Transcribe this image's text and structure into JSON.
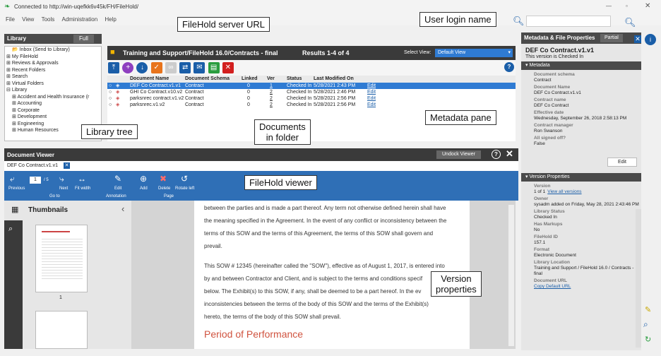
{
  "window": {
    "connected": "Connected to http://win-uqefkk6v45k/FH/FileHold/"
  },
  "menu": [
    "File",
    "View",
    "Tools",
    "Administration",
    "Help"
  ],
  "library": {
    "title": "Library",
    "full_button": "Full",
    "tree": [
      "Inbox (Send to Library)",
      "My FileHold",
      "Reviews & Approvals",
      "Recent Folders",
      "Search",
      "Virtual Folders",
      "Library",
      "Accident and Health Insurance (r",
      "Accounting",
      "Corporate",
      "Development",
      "Engineering",
      "Human Resources"
    ]
  },
  "folder": {
    "path": "Training and Support/FileHold 16.0/Contracts - final",
    "results": "Results 1-4 of 4",
    "select_view_label": "Select View:",
    "select_view_value": "Default View"
  },
  "grid": {
    "headers": [
      "Document Name",
      "Document Schema",
      "Linked",
      "Ver",
      "Status",
      "Last Modified On"
    ],
    "rows": [
      {
        "name": "DEF Co Contract.v1.v1",
        "schema": "Contract",
        "linked": "0",
        "ver": "1",
        "status": "Checked In",
        "modified": "5/28/2021 2:43 PM",
        "edit": "Edit"
      },
      {
        "name": "GHI Co Contract.v10.v2",
        "schema": "Contract",
        "linked": "0",
        "ver": "2",
        "status": "Checked In",
        "modified": "5/28/2021 2:46 PM",
        "edit": "Edit"
      },
      {
        "name": "parksnrec contract.v1.v2",
        "schema": "Contract",
        "linked": "0",
        "ver": "2",
        "status": "Checked In",
        "modified": "5/28/2021 2:56 PM",
        "edit": "Edit"
      },
      {
        "name": "parksnrec.v1.v2",
        "schema": "Contract",
        "linked": "0",
        "ver": "2",
        "status": "Checked In",
        "modified": "5/28/2021 2:56 PM",
        "edit": "Edit"
      }
    ]
  },
  "viewer": {
    "title": "Document Viewer",
    "undock": "Undock Viewer",
    "tab": "DEF Co Contract.v1.v1",
    "ribbon": {
      "previous": "Previous",
      "page_num": "1",
      "page_total": "/ 5",
      "next": "Next",
      "fit_width": "Fit width",
      "goto": "Go to",
      "edit": "Edit",
      "annotation": "Annotation",
      "add": "Add",
      "delete": "Delete",
      "rotate": "Rotate left",
      "page": "Page"
    },
    "thumbnails_title": "Thumbnails",
    "thumb_page": "1",
    "body": [
      "between the parties and is made a part thereof. Any term not otherwise defined herein shall have",
      "the meaning specified in the Agreement. In the event of any conflict or inconsistency between the",
      "terms of this SOW and the terms of this Agreement, the terms of this SOW shall govern and",
      "prevail.",
      "This SOW # 12345 (hereinafter called the \"SOW\"), effective as of August 1, 2017, is entered into",
      "by and between Contractor and Client, and is subject to the terms and conditions specif",
      "below. The Exhibit(s) to this SOW, if any, shall be deemed to be a part hereof. In the ev",
      "inconsistencies between the terms of the body of this SOW and the terms of the Exhibit(s)",
      "hereto, the terms of the body of this SOW shall prevail."
    ],
    "heading": "Period of Performance"
  },
  "meta": {
    "title": "Metadata & File Properties",
    "partial": "Partial",
    "doc": "DEF Co Contract.v1.v1",
    "checked": "This version is Checked In",
    "section": "Metadata",
    "fields": [
      [
        "Document schema",
        "Contract"
      ],
      [
        "Document Name",
        "DEF Co Contract.v1.v1"
      ],
      [
        "Contract name",
        "DEF Co Contract"
      ],
      [
        "Effective date",
        "Wednesday, September 26, 2018 2:58:13 PM"
      ],
      [
        "Contract manager",
        "Ron Swanson"
      ],
      [
        "All signed off?",
        "False"
      ]
    ],
    "edit": "Edit",
    "version_section": "Version Properties",
    "version": [
      [
        "Version",
        "1 of 1"
      ],
      [
        "Owner",
        "sysadm added on Friday, May 28, 2021 2:43:46 PM"
      ],
      [
        "Library Status",
        "Checked In"
      ],
      [
        "Has Markups",
        "No"
      ],
      [
        "FileHold ID",
        "157.1"
      ],
      [
        "Format",
        "Electronic Document"
      ],
      [
        "Library Location",
        "Training and Support / FileHold 16.0 / Contracts - final"
      ],
      [
        "Document URL",
        ""
      ]
    ],
    "view_all": "View all versions",
    "copy_url": "Copy Default URL"
  },
  "callouts": {
    "server": "FileHold server URL",
    "login": "User login name",
    "tree": "Library tree",
    "docs": "Documents\nin folder",
    "meta": "Metadata pane",
    "viewer": "FileHold viewer",
    "version": "Version\nproperties"
  }
}
